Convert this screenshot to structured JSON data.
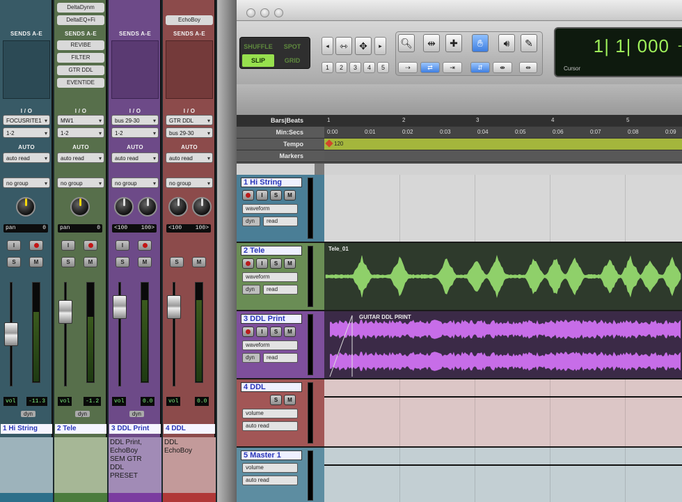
{
  "mixer": {
    "strips": [
      {
        "inserts": [],
        "sends_header": "SENDS A-E",
        "sends": [],
        "io_header": "I / O",
        "input": "FOCUSRITE1",
        "output": "1-2",
        "auto_header": "AUTO",
        "auto_mode": "auto read",
        "group": "no group",
        "pan": [
          "pan",
          "0"
        ],
        "vol_label": "vol",
        "vol_value": "-11.3",
        "dyn": "dyn",
        "name": "1 Hi String",
        "comments": ""
      },
      {
        "inserts": [
          "DeltaDynm",
          "DeltaEQ+Fi"
        ],
        "sends_header": "SENDS A-E",
        "sends": [
          "REVIBE",
          "FILTER",
          "GTR DDL",
          "EVENTIDE"
        ],
        "io_header": "I / O",
        "input": "MW1",
        "output": "1-2",
        "auto_header": "AUTO",
        "auto_mode": "auto read",
        "group": "no group",
        "pan": [
          "pan",
          "0"
        ],
        "vol_label": "vol",
        "vol_value": "-1.2",
        "dyn": "dyn",
        "name": "2 Tele",
        "comments": ""
      },
      {
        "inserts": [],
        "sends_header": "SENDS A-E",
        "sends": [],
        "io_header": "I / O",
        "input": "bus 29-30",
        "output": "1-2",
        "auto_header": "AUTO",
        "auto_mode": "auto read",
        "group": "no group",
        "pan": [
          "<100",
          "100>"
        ],
        "vol_label": "vol",
        "vol_value": "0.0",
        "dyn": "dyn",
        "name": "3 DDL Print",
        "comments": "DDL Print,\nEchoBoy\nSEM GTR\nDDL\nPRESET"
      },
      {
        "inserts": [
          "EchoBoy"
        ],
        "sends_header": "SENDS A-E",
        "sends": [],
        "io_header": "I / O",
        "input": "GTR DDL",
        "output": "bus 29-30",
        "auto_header": "AUTO",
        "auto_mode": "auto read",
        "group": "no group",
        "pan": [
          "<100",
          "100>"
        ],
        "vol_label": "vol",
        "vol_value": "0.0",
        "dyn": "",
        "name": "4 DDL",
        "comments": "DDL\nEchoBoy"
      }
    ],
    "button_labels": {
      "input": "I",
      "solo": "S",
      "mute": "M"
    }
  },
  "window": {
    "title_left": "",
    "title_right": "",
    "modes": {
      "shuffle": "SHUFFLE",
      "spot": "SPOT",
      "slip": "SLIP",
      "grid": "GRID"
    },
    "zoom_presets": [
      "1",
      "2",
      "3",
      "4",
      "5"
    ],
    "counter": {
      "value": "1| 1| 000",
      "label": "Cursor",
      "dash": "-"
    }
  },
  "rulers": {
    "labels": [
      "Bars|Beats",
      "Min:Secs",
      "Tempo",
      "Markers"
    ],
    "bars": [
      "1",
      "2",
      "3",
      "4",
      "5"
    ],
    "secs": [
      "0:00",
      "0:01",
      "0:02",
      "0:03",
      "0:04",
      "0:05",
      "0:06",
      "0:07",
      "0:08",
      "0:09"
    ],
    "tempo": "120"
  },
  "tracks": [
    {
      "name": "1 Hi String",
      "view": "waveform",
      "auto": "read",
      "dyn": "dyn",
      "clip": "",
      "color": "#4a7e96"
    },
    {
      "name": "2 Tele",
      "view": "waveform",
      "auto": "read",
      "dyn": "dyn",
      "clip": "Tele_01",
      "color": "#6a8d55"
    },
    {
      "name": "3 DDL Print",
      "view": "waveform",
      "auto": "read",
      "dyn": "dyn",
      "clip": "GUITAR DDL PRINT",
      "color": "#7e4f9c"
    },
    {
      "name": "4 DDL",
      "view": "volume",
      "auto": "auto read",
      "dyn": "",
      "clip": "",
      "color": "#a25656"
    },
    {
      "name": "5 Master 1",
      "view": "volume",
      "auto": "auto read",
      "dyn": "",
      "clip": "",
      "color": "#5d8da1"
    }
  ],
  "track_buttons": {
    "input": "I",
    "solo": "S",
    "mute": "M"
  },
  "colors": {
    "waveform_green": "#8fd06a",
    "waveform_purple": "#c76de8",
    "counter_green": "#9ef05a"
  }
}
